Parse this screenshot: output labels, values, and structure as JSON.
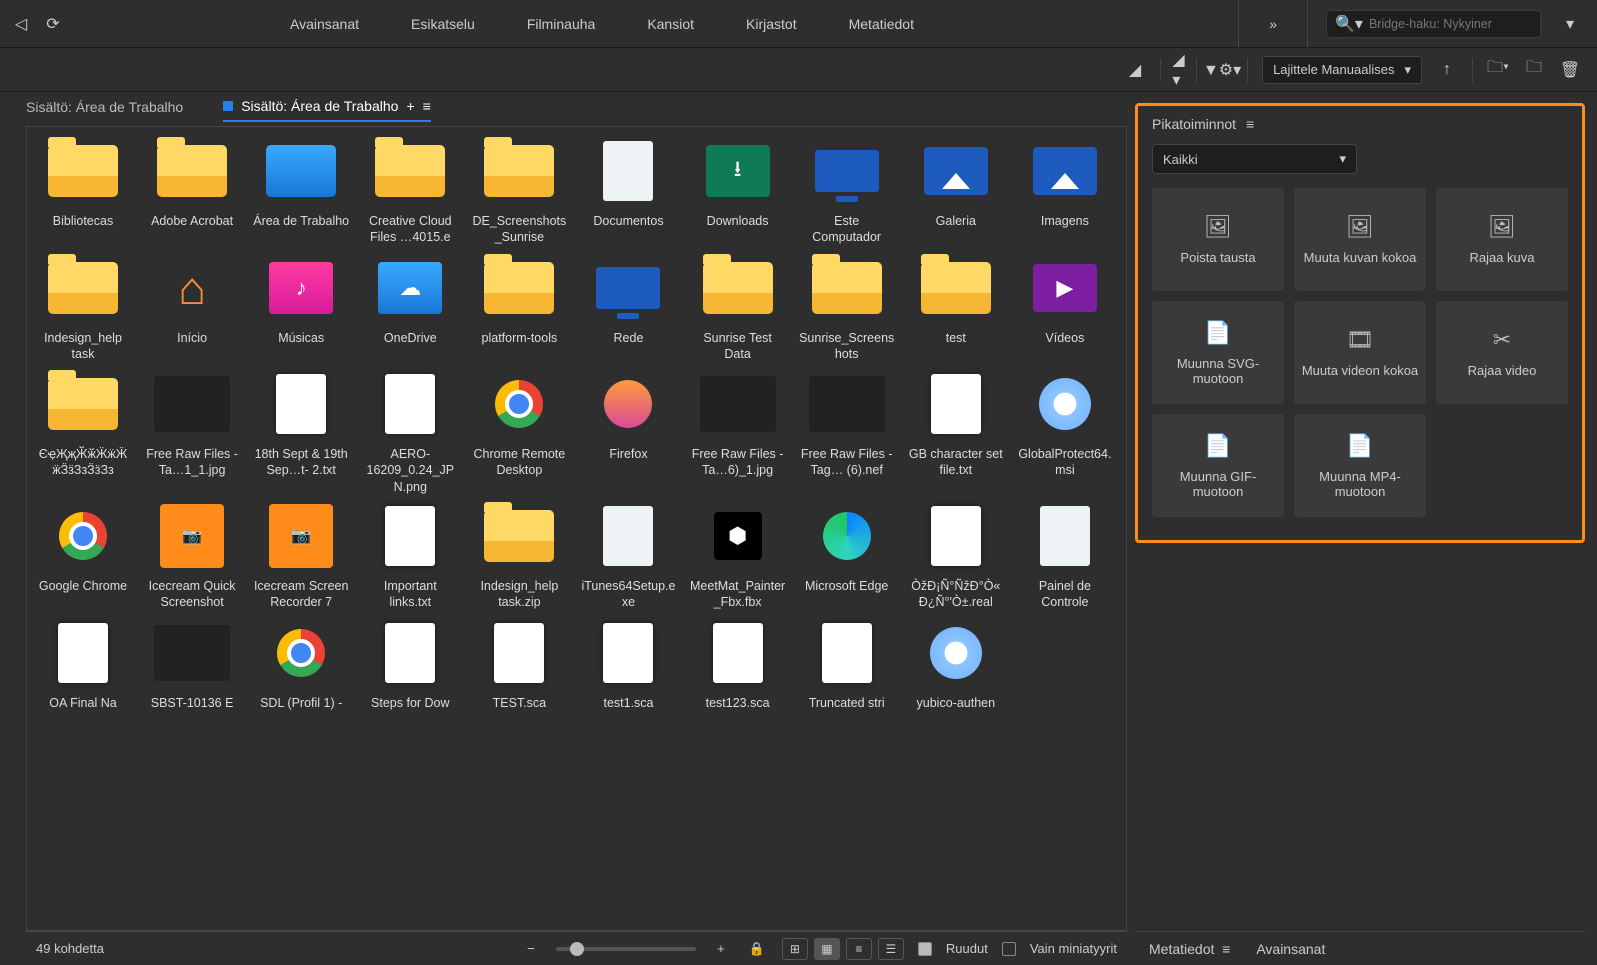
{
  "menubar": {
    "items": [
      "Avainsanat",
      "Esikatselu",
      "Filminauha",
      "Kansiot",
      "Kirjastot",
      "Metatiedot"
    ],
    "search_placeholder": "Bridge-haku: Nykyiner"
  },
  "toolbar": {
    "sort_label": "Lajittele Manuaalises"
  },
  "tabs": [
    {
      "label": "Sisältö: Área de Trabalho",
      "active": false
    },
    {
      "label": "Sisältö: Área de Trabalho",
      "active": true
    }
  ],
  "items": [
    {
      "name": "Bibliotecas",
      "icon": "folder-yellow"
    },
    {
      "name": "Adobe Acrobat",
      "icon": "folder-yellow"
    },
    {
      "name": "Área de Trabalho",
      "icon": "folder-blue"
    },
    {
      "name": "Creative Cloud Files …4015.e",
      "icon": "folder-yellow"
    },
    {
      "name": "DE_Screenshots_Sunrise",
      "icon": "folder-yellow"
    },
    {
      "name": "Documentos",
      "icon": "doc-light"
    },
    {
      "name": "Downloads",
      "icon": "download-grn"
    },
    {
      "name": "Este Computador",
      "icon": "monitor"
    },
    {
      "name": "Galeria",
      "icon": "pic"
    },
    {
      "name": "Imagens",
      "icon": "pic"
    },
    {
      "name": "Indesign_help task",
      "icon": "folder-yellow"
    },
    {
      "name": "Início",
      "icon": "house"
    },
    {
      "name": "Músicas",
      "icon": "music-pink"
    },
    {
      "name": "OneDrive",
      "icon": "onedrive"
    },
    {
      "name": "platform-tools",
      "icon": "folder-yellow"
    },
    {
      "name": "Rede",
      "icon": "monitor"
    },
    {
      "name": "Sunrise Test Data",
      "icon": "folder-yellow"
    },
    {
      "name": "Sunrise_Screenshots",
      "icon": "folder-yellow"
    },
    {
      "name": "test",
      "icon": "folder-yellow"
    },
    {
      "name": "Vídeos",
      "icon": "video-purple"
    },
    {
      "name": "ЄҿҖҗӁӂӜӝӜӝӞӟЗзӞӟЗз",
      "icon": "folder-yellow"
    },
    {
      "name": "Free Raw Files - Ta…1_1.jpg",
      "icon": "image-dark"
    },
    {
      "name": "18th Sept & 19th Sep…t- 2.txt",
      "icon": "doc-white"
    },
    {
      "name": "AERO-16209_0.24_JPN.png",
      "icon": "doc-white"
    },
    {
      "name": "Chrome Remote Desktop",
      "icon": "chrome-ball"
    },
    {
      "name": "Firefox",
      "icon": "fx-ball"
    },
    {
      "name": "Free Raw Files - Ta…6)_1.jpg",
      "icon": "image-dark"
    },
    {
      "name": "Free Raw Files - Tag… (6).nef",
      "icon": "image-dark"
    },
    {
      "name": "GB character set file.txt",
      "icon": "doc-white"
    },
    {
      "name": "GlobalProtect64.msi",
      "icon": "disc"
    },
    {
      "name": "Google Chrome",
      "icon": "chrome-ball"
    },
    {
      "name": "Icecream Quick Screenshot",
      "icon": "orange-sq"
    },
    {
      "name": "Icecream Screen Recorder 7",
      "icon": "orange-sq"
    },
    {
      "name": "Important links.txt",
      "icon": "doc-white"
    },
    {
      "name": "Indesign_help task.zip",
      "icon": "folder-yellow"
    },
    {
      "name": "iTunes64Setup.exe",
      "icon": "doc-light"
    },
    {
      "name": "MeetMat_Painter_Fbx.fbx",
      "icon": "black-cube"
    },
    {
      "name": "Microsoft Edge",
      "icon": "edge"
    },
    {
      "name": "ÒžÐ¡Ñ°ÑžÐ°Ò«Ð¿Ñ°'Ò±.real",
      "icon": "doc-white"
    },
    {
      "name": "Painel de Controle",
      "icon": "doc-light"
    },
    {
      "name": "OA Final Na",
      "icon": "doc-white"
    },
    {
      "name": "SBST-10136 E",
      "icon": "image-dark"
    },
    {
      "name": "SDL (Profil 1) -",
      "icon": "chrome-ball"
    },
    {
      "name": "Steps for Dow",
      "icon": "doc-white"
    },
    {
      "name": "TEST.sca",
      "icon": "doc-white"
    },
    {
      "name": "test1.sca",
      "icon": "doc-white"
    },
    {
      "name": "test123.sca",
      "icon": "doc-white"
    },
    {
      "name": "Truncated stri",
      "icon": "doc-white"
    },
    {
      "name": "yubico-authen",
      "icon": "disc"
    }
  ],
  "bottombar": {
    "count_label": "49 kohdetta",
    "ruudut": "Ruudut",
    "mini": "Vain miniatyyrit"
  },
  "quick_actions": {
    "title": "Pikatoiminnot",
    "filter": "Kaikki",
    "cards": [
      {
        "label": "Poista tausta",
        "icon": "🖼"
      },
      {
        "label": "Muuta kuvan kokoa",
        "icon": "🖼"
      },
      {
        "label": "Rajaa kuva",
        "icon": "🖼"
      },
      {
        "label": "Muunna SVG-muotoon",
        "icon": "📄"
      },
      {
        "label": "Muuta videon kokoa",
        "icon": "🎞"
      },
      {
        "label": "Rajaa video",
        "icon": "✂"
      },
      {
        "label": "Muunna GIF-muotoon",
        "icon": "📄"
      },
      {
        "label": "Muunna MP4-muotoon",
        "icon": "📄"
      }
    ]
  },
  "meta_tabs": {
    "a": "Metatiedot",
    "b": "Avainsanat"
  }
}
